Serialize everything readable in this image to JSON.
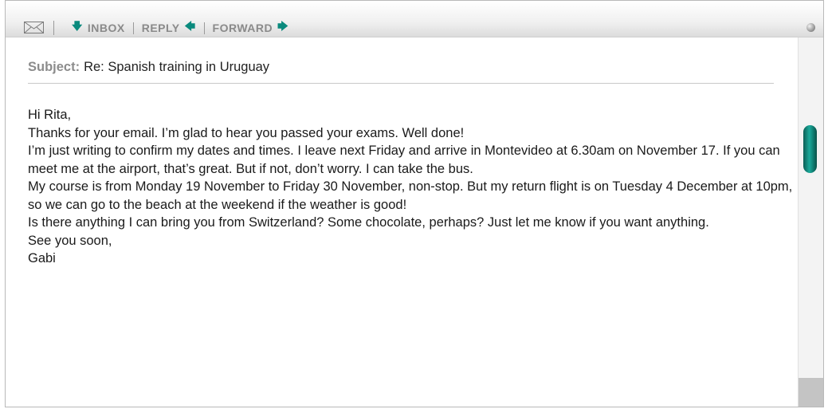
{
  "toolbar": {
    "mail_icon": "envelope-icon",
    "inbox_arrow": "🡇",
    "inbox_label": "INBOX",
    "reply_label": "REPLY",
    "reply_arrow": "🡄",
    "forward_label": "FORWARD",
    "forward_arrow": "🡆",
    "accent_color": "#0a8a7d"
  },
  "email": {
    "subject_label": "Subject:",
    "subject": "Re: Spanish training in Uruguay",
    "lines": [
      "Hi Rita,",
      "Thanks for your email. I’m glad to hear you passed your exams. Well done!",
      "I’m just writing to confirm my dates and times. I leave next Friday and arrive in Montevideo at 6.30am on November 17. If you can meet me at the airport, that’s great. But if not, don’t worry. I can take the bus.",
      "My course is from Monday 19 November to Friday 30 November, non-stop. But my return flight is on Tuesday 4 December at 10pm, so we can go to the beach at the weekend if the weather is good!",
      "Is there anything I can bring you from Switzerland? Some chocolate, perhaps? Just let me know if you want anything.",
      "See you soon,",
      "Gabi"
    ]
  }
}
